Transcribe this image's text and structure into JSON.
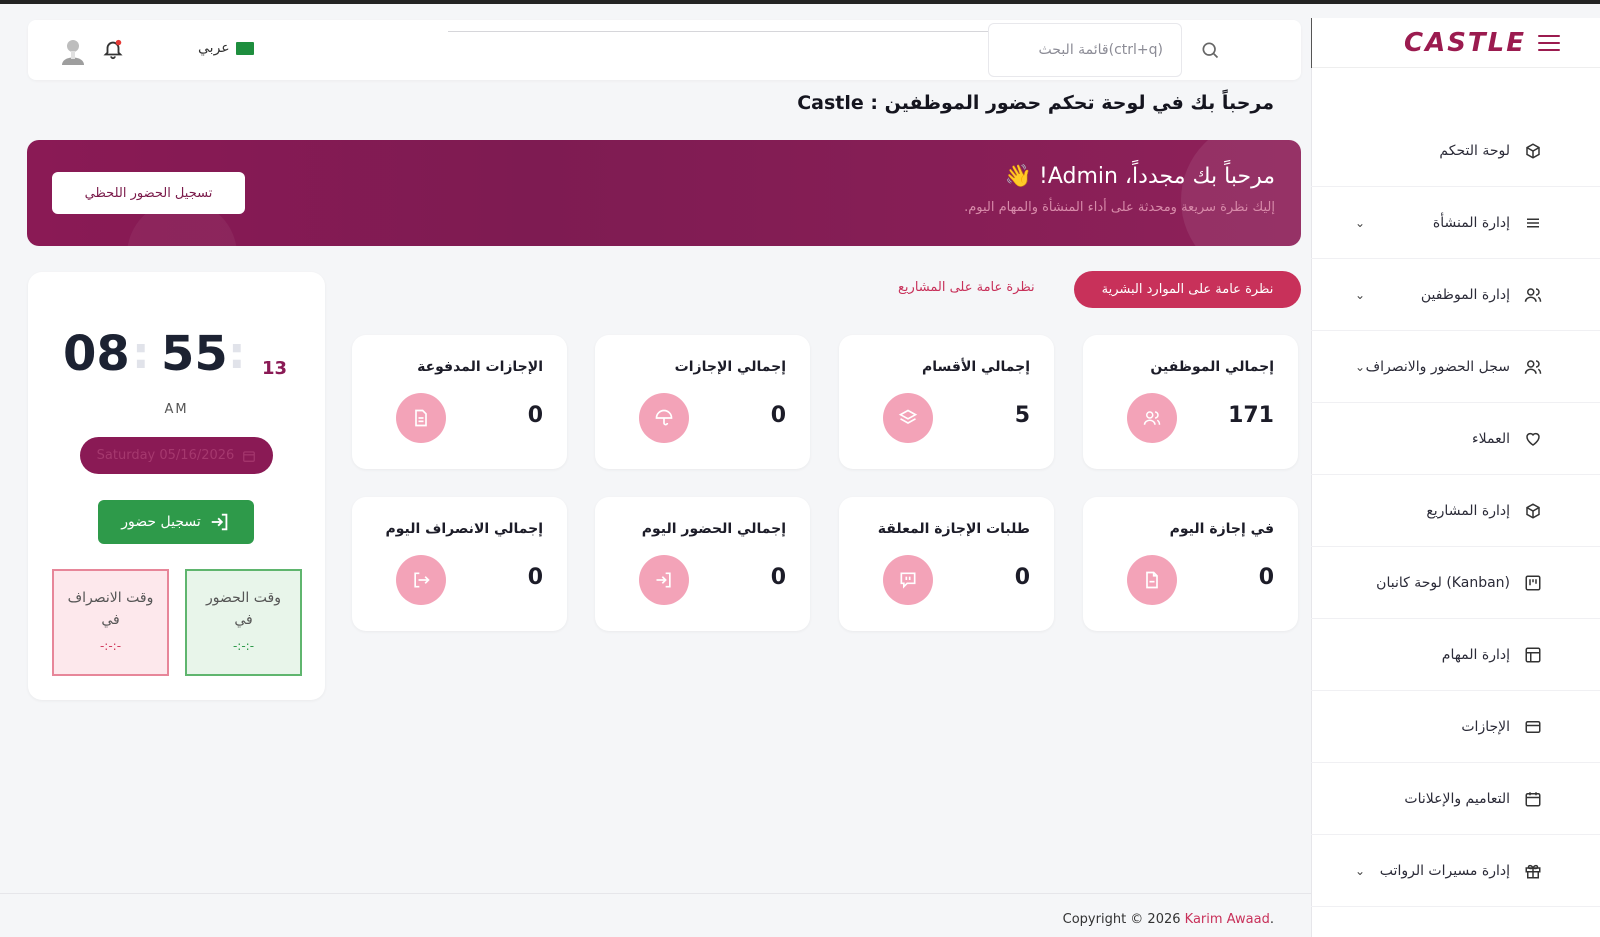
{
  "header": {
    "search_placeholder": "قائمة البحث(ctrl+q)",
    "language": "عربي"
  },
  "sidebar": {
    "logo": "CASTLE",
    "items": [
      {
        "label": "لوحة التحكم",
        "icon": "box-icon",
        "chevron": false
      },
      {
        "label": "إدارة المنشأة",
        "icon": "list-icon",
        "chevron": true
      },
      {
        "label": "إدارة الموظفين",
        "icon": "users-icon",
        "chevron": true
      },
      {
        "label": "سجل الحضور والانصراف",
        "icon": "users-icon",
        "chevron": true
      },
      {
        "label": "العملاء",
        "icon": "heart-icon",
        "chevron": false
      },
      {
        "label": "إدارة المشاريع",
        "icon": "box-icon",
        "chevron": false
      },
      {
        "label": "لوحة كانبان (Kanban)",
        "icon": "kanban-icon",
        "chevron": false
      },
      {
        "label": "إدارة المهام",
        "icon": "table-icon",
        "chevron": false
      },
      {
        "label": "الإجازات",
        "icon": "card-icon",
        "chevron": false
      },
      {
        "label": "التعاميم والإعلانات",
        "icon": "calendar-icon",
        "chevron": false
      },
      {
        "label": "إدارة مسيرات الرواتب",
        "icon": "gift-icon",
        "chevron": true
      }
    ]
  },
  "page": {
    "title": "مرحباً بك في لوحة تحكم حضور الموظفين : Castle"
  },
  "banner": {
    "title": "مرحباً بك مجدداً، Admin! 👋",
    "subtitle": "إليك نظرة سريعة ومحدثة على أداء المنشأة والمهام اليوم.",
    "button": "تسجيل الحضور اللحظي"
  },
  "tabs": {
    "active": "نظرة عامة على الموارد البشرية",
    "other": "نظرة عامة على المشاريع"
  },
  "stats": {
    "row1": [
      {
        "title": "إجمالي الموظفين",
        "value": "171",
        "icon": "users-icon"
      },
      {
        "title": "إجمالي الأقسام",
        "value": "5",
        "icon": "layers-icon"
      },
      {
        "title": "إجمالي الإجازات",
        "value": "0",
        "icon": "umbrella-icon"
      },
      {
        "title": "الإجازات المدفوعة",
        "value": "0",
        "icon": "document-icon"
      }
    ],
    "row2": [
      {
        "title": "في إجازة اليوم",
        "value": "0",
        "icon": "file-icon"
      },
      {
        "title": "طلبات الإجازة المعلقة",
        "value": "0",
        "icon": "message-icon"
      },
      {
        "title": "إجمالي الحضور اليوم",
        "value": "0",
        "icon": "login-icon"
      },
      {
        "title": "إجمالي الانصراف اليوم",
        "value": "0",
        "icon": "logout-icon"
      }
    ]
  },
  "clock": {
    "hours": "08",
    "minutes": "55",
    "seconds": "13",
    "ampm": "AM",
    "date": "Saturday 05/16/2026",
    "checkin_button": "تسجيل حضور",
    "checkin_label": "وقت الحضور في",
    "checkin_value": "-:-:-",
    "checkout_label": "وقت الانصراف في",
    "checkout_value": "-:-:-"
  },
  "footer": {
    "copyright": "Copyright © 2026 ",
    "author": "Karim Awaad",
    "suffix": "."
  },
  "colors": {
    "brand": "#8a1a55",
    "accent": "#c8315a",
    "icon_bg": "#f3a3b8",
    "success": "#2e9a4a"
  }
}
